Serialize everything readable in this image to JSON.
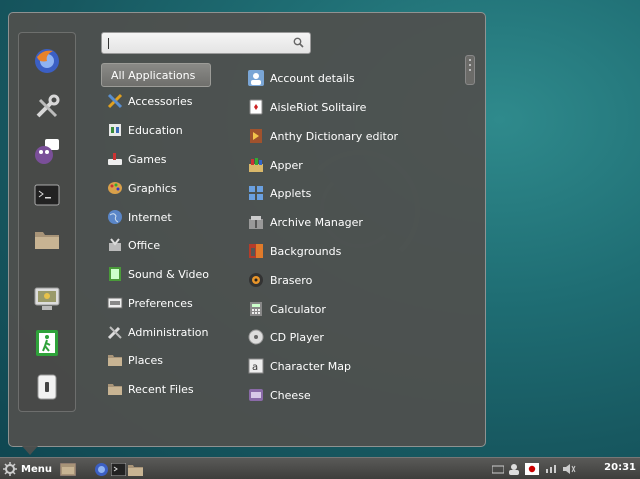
{
  "search": {
    "placeholder": ""
  },
  "favorites": [
    {
      "name": "Firefox"
    },
    {
      "name": "System Settings"
    },
    {
      "name": "Pidgin"
    },
    {
      "name": "Terminal"
    },
    {
      "name": "Files"
    },
    {
      "name": "Lock Screen"
    },
    {
      "name": "Logout"
    },
    {
      "name": "Shutdown"
    }
  ],
  "categories": [
    {
      "label": "All Applications",
      "icon": "all-apps"
    },
    {
      "label": "Accessories",
      "icon": "accessories-icon"
    },
    {
      "label": "Education",
      "icon": "education-icon"
    },
    {
      "label": "Games",
      "icon": "games-icon"
    },
    {
      "label": "Graphics",
      "icon": "graphics-icon"
    },
    {
      "label": "Internet",
      "icon": "internet-icon"
    },
    {
      "label": "Office",
      "icon": "office-icon"
    },
    {
      "label": "Sound & Video",
      "icon": "sound-video-icon"
    },
    {
      "label": "Preferences",
      "icon": "preferences-icon"
    },
    {
      "label": "Administration",
      "icon": "administration-icon"
    },
    {
      "label": "Places",
      "icon": "folder-icon"
    },
    {
      "label": "Recent Files",
      "icon": "folder-icon"
    }
  ],
  "apps": [
    {
      "label": "Account details",
      "icon": "account-icon"
    },
    {
      "label": "AisleRiot Solitaire",
      "icon": "cards-icon"
    },
    {
      "label": "Anthy Dictionary editor",
      "icon": "dictionary-icon"
    },
    {
      "label": "Apper",
      "icon": "apper-icon"
    },
    {
      "label": "Applets",
      "icon": "applets-icon"
    },
    {
      "label": "Archive Manager",
      "icon": "archive-icon"
    },
    {
      "label": "Backgrounds",
      "icon": "backgrounds-icon"
    },
    {
      "label": "Brasero",
      "icon": "brasero-icon"
    },
    {
      "label": "Calculator",
      "icon": "calculator-icon"
    },
    {
      "label": "CD Player",
      "icon": "cd-icon"
    },
    {
      "label": "Character Map",
      "icon": "charmap-icon"
    },
    {
      "label": "Cheese",
      "icon": "cheese-icon"
    }
  ],
  "panel": {
    "menu_label": "Menu",
    "clock": "20:31"
  },
  "colors": {
    "desktop": "#1f6e74",
    "menu_bg": "#50504e",
    "selected_bg": "#7d7d7a"
  }
}
